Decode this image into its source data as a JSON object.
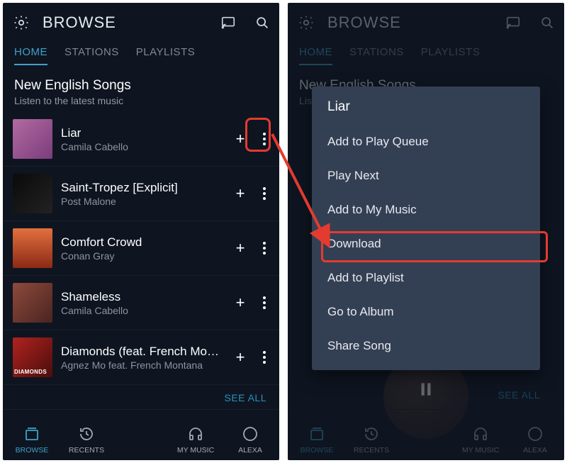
{
  "colors": {
    "accent": "#3fa1c9",
    "annotation": "#e33b2f",
    "menu_bg": "#334054"
  },
  "top": {
    "title": "BROWSE"
  },
  "tabs": [
    "HOME",
    "STATIONS",
    "PLAYLISTS"
  ],
  "active_tab_index": 0,
  "section": {
    "title": "New English Songs",
    "subtitle": "Listen to the latest music"
  },
  "songs": [
    {
      "title": "Liar",
      "artist": "Camila Cabello"
    },
    {
      "title": "Saint-Tropez [Explicit]",
      "artist": "Post Malone"
    },
    {
      "title": "Comfort Crowd",
      "artist": "Conan Gray"
    },
    {
      "title": "Shameless",
      "artist": "Camila Cabello"
    },
    {
      "title": "Diamonds (feat. French Mont…",
      "artist": "Agnez Mo feat. French Montana"
    }
  ],
  "see_all": "SEE ALL",
  "bottom_nav": [
    {
      "label": "BROWSE"
    },
    {
      "label": "RECENTS"
    },
    {
      "label": "MY MUSIC"
    },
    {
      "label": "ALEXA"
    }
  ],
  "bottom_nav_left": [
    {
      "label": "BROWSE"
    },
    {
      "label": "RECENTS"
    },
    {
      "label": "MY MUSIC"
    },
    {
      "label": "ALEXA"
    }
  ],
  "active_nav_index": 0,
  "context_menu": {
    "title": "Liar",
    "items": [
      "Add to Play Queue",
      "Play Next",
      "Add to My Music",
      "Download",
      "Add to Playlist",
      "Go to Album",
      "Share Song"
    ],
    "highlighted_index": 3
  }
}
